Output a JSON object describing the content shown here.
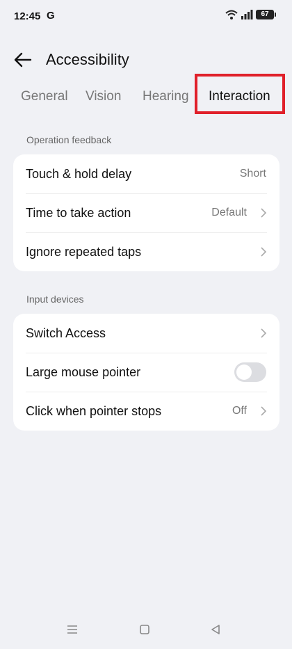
{
  "status_bar": {
    "time": "12:45",
    "g_label": "G",
    "battery": "67",
    "icons": [
      "wifi-icon",
      "signal-icon",
      "battery-icon"
    ]
  },
  "header": {
    "title": "Accessibility"
  },
  "tabs": [
    {
      "label": "General",
      "active": false
    },
    {
      "label": "Vision",
      "active": false
    },
    {
      "label": "Hearing",
      "active": false
    },
    {
      "label": "Interaction",
      "active": true
    }
  ],
  "sections": {
    "operation_feedback": {
      "label": "Operation feedback",
      "rows": [
        {
          "label": "Touch & hold delay",
          "value": "Short"
        },
        {
          "label": "Time to take action",
          "value": "Default"
        },
        {
          "label": "Ignore repeated taps",
          "value": ""
        }
      ]
    },
    "input_devices": {
      "label": "Input devices",
      "rows": [
        {
          "label": "Switch Access",
          "value": ""
        },
        {
          "label": "Large mouse pointer",
          "toggle": "off"
        },
        {
          "label": "Click when pointer stops",
          "value": "Off"
        }
      ]
    }
  },
  "colors": {
    "background": "#f0f1f5",
    "card": "#ffffff",
    "highlight": "#e0202a",
    "secondary_text": "#777777"
  },
  "nav_bar": {
    "icons": [
      "menu-icon",
      "home-icon",
      "back-triangle-icon"
    ]
  }
}
